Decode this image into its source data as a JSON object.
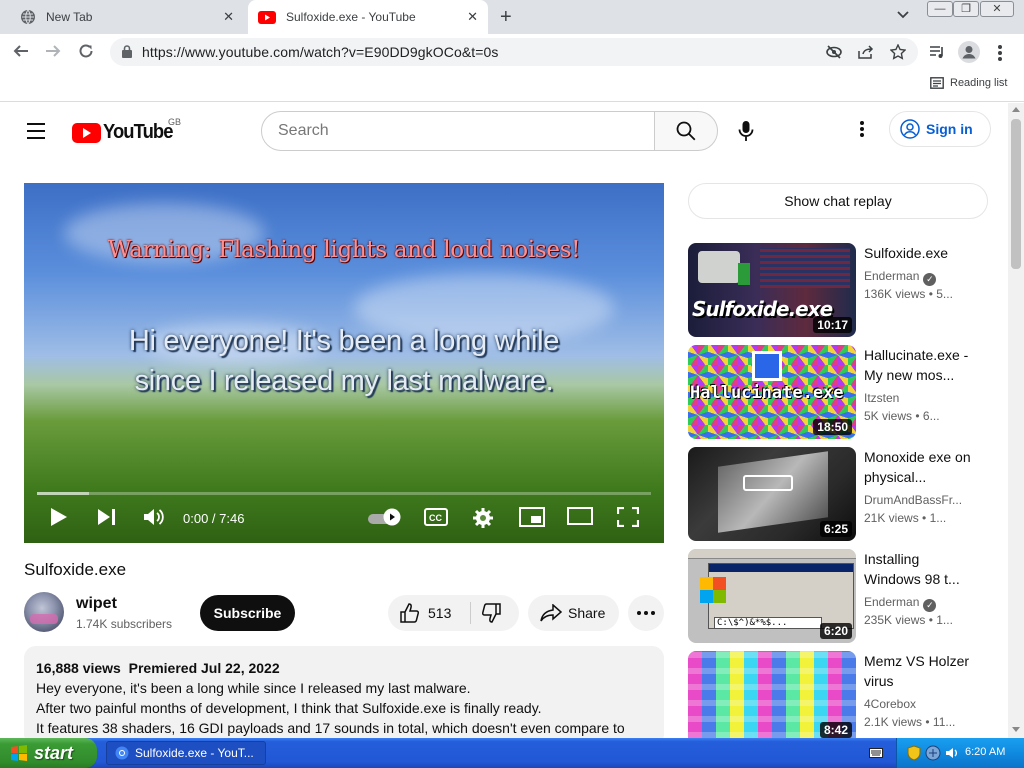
{
  "browser": {
    "tabs": [
      {
        "title": "New Tab",
        "active": false
      },
      {
        "title": "Sulfoxide.exe - YouTube",
        "active": true
      }
    ],
    "url": "https://www.youtube.com/watch?v=E90DD9gkOCo&t=0s",
    "reading_list": "Reading list"
  },
  "youtube": {
    "logo_text": "YouTube",
    "country_code": "GB",
    "search_placeholder": "Search",
    "sign_in": "Sign in"
  },
  "player": {
    "warning_text": "Warning: Flashing lights and loud noises!",
    "subtitle_line1": "Hi everyone! It's been a long while",
    "subtitle_line2": "since I released my last malware.",
    "time": "0:00 / 7:46",
    "progress_fraction": 0.0
  },
  "video": {
    "title": "Sulfoxide.exe",
    "channel": "wipet",
    "subscribers": "1.74K subscribers",
    "subscribe_label": "Subscribe",
    "likes": "513",
    "share_label": "Share",
    "views": "16,888 views",
    "premiered": "Premiered Jul 22, 2022",
    "description": [
      "Hey everyone, it's been a long while since I released my last malware.",
      "After two painful months of development, I think that Sulfoxide.exe is finally ready.",
      "It features 38 shaders, 16 GDI payloads and 17 sounds in total, which doesn't even compare to"
    ]
  },
  "sidebar": {
    "chat_replay": "Show chat replay",
    "recommendations": [
      {
        "title": "Sulfoxide.exe",
        "channel": "Enderman",
        "verified": true,
        "views": "136K views",
        "age": "• 5...",
        "duration": "10:17",
        "thumb_text": "Sulfoxide.exe"
      },
      {
        "title": "Hallucinate.exe - My new mos...",
        "channel": "Itzsten",
        "verified": false,
        "views": "5K views",
        "age": "• 6...",
        "duration": "18:50",
        "thumb_text": "Hallucinate.exe"
      },
      {
        "title": "Monoxide exe on physical...",
        "channel": "DrumAndBassFr...",
        "verified": false,
        "views": "21K views",
        "age": "• 1...",
        "duration": "6:25",
        "thumb_text": ""
      },
      {
        "title": "Installing Windows 98 t...",
        "channel": "Enderman",
        "verified": true,
        "views": "235K views",
        "age": "• 1...",
        "duration": "6:20",
        "thumb_text": "C:\\$^)&*%$..."
      },
      {
        "title": "Memz VS Holzer virus",
        "channel": "4Corebox",
        "verified": false,
        "views": "2.1K views",
        "age": "• 11...",
        "duration": "8:42",
        "thumb_text": ""
      }
    ]
  },
  "taskbar": {
    "start_label": "start",
    "task_item": "Sulfoxide.exe - YouT...",
    "clock": "6:20 AM"
  },
  "colors": {
    "youtube_red": "#ff0000",
    "link_blue": "#065fd4",
    "xp_blue": "#245edb",
    "xp_green": "#3a9b34"
  }
}
